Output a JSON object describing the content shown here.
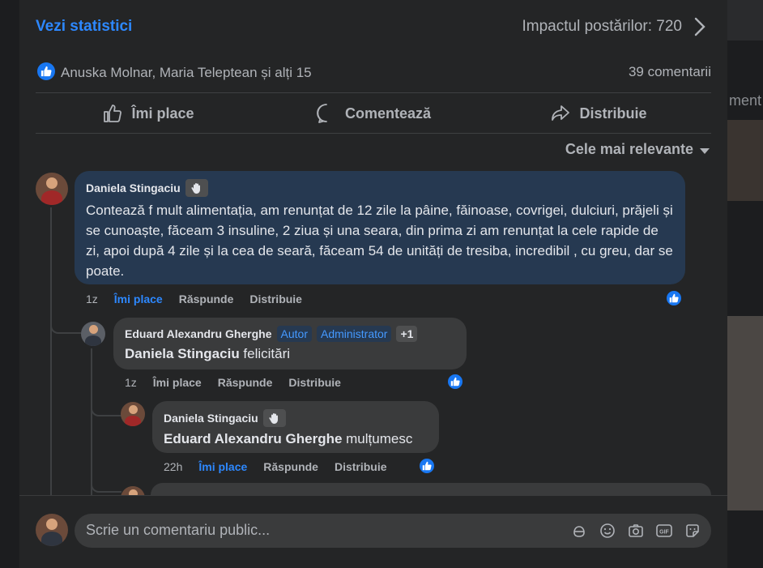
{
  "stats": {
    "link": "Vezi statistici",
    "impact": "Impactul postărilor: 720"
  },
  "reactions": {
    "names": "Anuska Molnar, Maria Teleptean și alți 15",
    "comments_count": "39 comentarii"
  },
  "actions": {
    "like": "Îmi place",
    "comment": "Comentează",
    "share": "Distribuie"
  },
  "sort": {
    "label": "Cele mai relevante"
  },
  "background": {
    "peek_text": "ment"
  },
  "comments": [
    {
      "author": "Daniela Stingaciu",
      "text": "Contează f mult alimentația, am renunțat de 12 zile la pâine, făinoase, covrigei, dulciuri, prăjeli și se cunoaște, făceam 3 insuline, 2 ziua și una seara, din prima zi am renunțat la cele rapide de zi, apoi după 4 zile și la cea de seară, făceam 54 de unități de tresiba, incredibil , cu greu, dar se poate.",
      "time": "1z",
      "like": "Îmi place",
      "reply": "Răspunde",
      "share": "Distribuie"
    },
    {
      "author": "Eduard Alexandru Gherghe",
      "tags": [
        "Autor",
        "Administrator",
        "+1"
      ],
      "mention": "Daniela Stingaciu",
      "text": " felicitări",
      "time": "1z",
      "like": "Îmi place",
      "reply": "Răspunde",
      "share": "Distribuie"
    },
    {
      "author": "Daniela Stingaciu",
      "mention": "Eduard Alexandru Gherghe",
      "text": " mulțumesc",
      "time": "22h",
      "like": "Îmi place",
      "reply": "Răspunde",
      "share": "Distribuie"
    }
  ],
  "composer": {
    "placeholder": "Scrie un comentariu public..."
  },
  "colors": {
    "accent": "#2d88ff",
    "panel": "#242526",
    "bubble": "#3a3b3c",
    "highlight_bubble": "#263951"
  }
}
